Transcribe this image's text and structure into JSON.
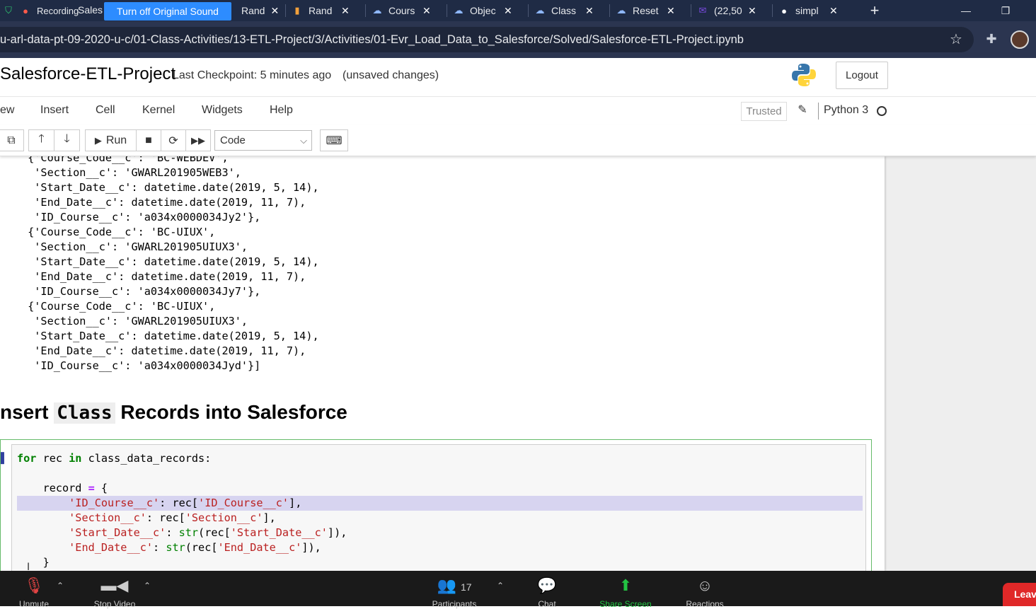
{
  "browser": {
    "tabs": [
      {
        "label": "Sales",
        "favicon": "zoom-recording-icon"
      },
      {
        "label": "Rand",
        "favicon": "book-icon"
      },
      {
        "label": "Rand",
        "favicon": "book-icon"
      },
      {
        "label": "Cours",
        "favicon": "salesforce-cloud-icon"
      },
      {
        "label": "Objec",
        "favicon": "salesforce-cloud-icon"
      },
      {
        "label": "Class",
        "favicon": "salesforce-cloud-icon"
      },
      {
        "label": "Reset",
        "favicon": "salesforce-cloud-icon"
      },
      {
        "label": "(22,50",
        "favicon": "mail-icon"
      },
      {
        "label": "simpl",
        "favicon": "github-icon"
      }
    ],
    "recording_label": "Recording",
    "sound_pill": "Turn off Original Sound",
    "new_tab": "+",
    "minimize": "—",
    "maximize": "❐",
    "url": "u-arl-data-pt-09-2020-u-c/01-Class-Activities/13-ETL-Project/3/Activities/01-Evr_Load_Data_to_Salesforce/Solved/Salesforce-ETL-Project.ipynb"
  },
  "jupyter": {
    "title": "Salesforce-ETL-Project",
    "checkpoint": "Last Checkpoint: 5 minutes ago",
    "unsaved": "(unsaved changes)",
    "logout": "Logout",
    "menu": [
      "ew",
      "Insert",
      "Cell",
      "Kernel",
      "Widgets",
      "Help"
    ],
    "trusted": "Trusted",
    "kernel": "Python 3",
    "toolbar": {
      "run": "Run",
      "cell_type": "Code"
    }
  },
  "output_lines": [
    " {'Course_Code__c': 'BC-WEBDEV',",
    "  'Section__c': 'GWARL201905WEB3',",
    "  'Start_Date__c': datetime.date(2019, 5, 14),",
    "  'End_Date__c': datetime.date(2019, 11, 7),",
    "  'ID_Course__c': 'a034x0000034Jy2'},",
    " {'Course_Code__c': 'BC-UIUX',",
    "  'Section__c': 'GWARL201905UIUX3',",
    "  'Start_Date__c': datetime.date(2019, 5, 14),",
    "  'End_Date__c': datetime.date(2019, 11, 7),",
    "  'ID_Course__c': 'a034x0000034Jy7'},",
    " {'Course_Code__c': 'BC-UIUX',",
    "  'Section__c': 'GWARL201905UIUX3',",
    "  'Start_Date__c': datetime.date(2019, 5, 14),",
    "  'End_Date__c': datetime.date(2019, 11, 7),",
    "  'ID_Course__c': 'a034x0000034Jyd'}]"
  ],
  "heading": {
    "pre": "nsert",
    "code": "Class",
    "post": "Records into Salesforce"
  },
  "code": {
    "line1_kw1": "for",
    "line1_mid1": " rec ",
    "line1_kw2": "in",
    "line1_rest": " class_data_records:",
    "line3_a": "    record ",
    "line3_eq": "=",
    "line3_b": " {",
    "line4_key": "'ID_Course__c'",
    "line4_mid": ": rec[",
    "line4_idx": "'ID_Course__c'",
    "line4_end": "],",
    "line5_key": "'Section__c'",
    "line5_mid": ": rec[",
    "line5_idx": "'Section__c'",
    "line5_end": "],",
    "line6_key": "'Start_Date__c'",
    "line6_mid": ": ",
    "line6_fn": "str",
    "line6_mid2": "(rec[",
    "line6_idx": "'Start_Date__c'",
    "line6_end": "]),",
    "line7_key": "'End_Date__c'",
    "line7_mid": ": ",
    "line7_fn": "str",
    "line7_mid2": "(rec[",
    "line7_idx": "'End_Date__c'",
    "line7_end": "]),",
    "line8": "    }"
  },
  "zoom": {
    "unmute": "Unmute",
    "stop_video": "Stop Video",
    "participants_count": "17",
    "participants": "Participants",
    "chat": "Chat",
    "share": "Share Screen",
    "reactions": "Reactions",
    "leave": "Leav"
  },
  "colors": {
    "tabbar_bg": "#1f2b45",
    "addr_bg": "#2b3550",
    "zoom_share": "#23c343",
    "leave_red": "#e02828"
  }
}
